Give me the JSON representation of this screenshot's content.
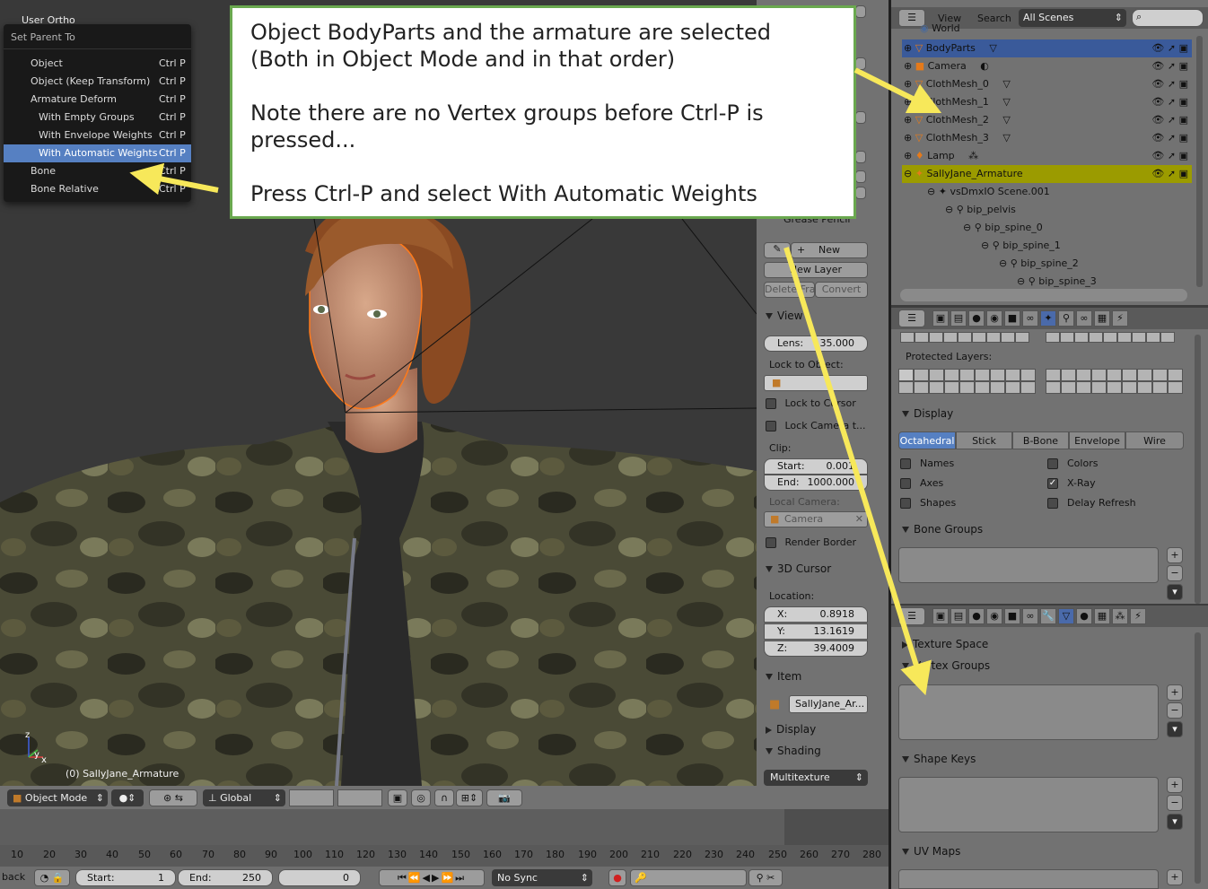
{
  "viewport": {
    "view_name": "User Ortho",
    "object_label": "(0) SallyJane_Armature",
    "axis_x": "x",
    "axis_y": "y",
    "axis_z": "z"
  },
  "parent_menu": {
    "title": "Set Parent To",
    "items": [
      {
        "label": "Object",
        "shortcut": "Ctrl P",
        "indent": false,
        "highlighted": false
      },
      {
        "label": "Object (Keep Transform)",
        "shortcut": "Ctrl P",
        "indent": false,
        "highlighted": false
      },
      {
        "label": "Armature Deform",
        "shortcut": "Ctrl P",
        "indent": false,
        "highlighted": false
      },
      {
        "label": "With Empty Groups",
        "shortcut": "Ctrl P",
        "indent": true,
        "highlighted": false
      },
      {
        "label": "With Envelope Weights",
        "shortcut": "Ctrl P",
        "indent": true,
        "highlighted": false
      },
      {
        "label": "With Automatic Weights",
        "shortcut": "Ctrl P",
        "indent": true,
        "highlighted": true
      },
      {
        "label": "Bone",
        "shortcut": "Ctrl P",
        "indent": false,
        "highlighted": false
      },
      {
        "label": "Bone Relative",
        "shortcut": "Ctrl P",
        "indent": false,
        "highlighted": false
      }
    ]
  },
  "callout": {
    "line1": "Object BodyParts and the armature are selected",
    "line2": "(Both in Object Mode and in that order)",
    "line3": "Note there are no Vertex groups before Ctrl-P is",
    "line4": "pressed...",
    "line5": "Press Ctrl-P and select With Automatic Weights"
  },
  "sidebar": {
    "grease_pencil": "Grease Pencil",
    "new_label": "New",
    "new_layer": "New Layer",
    "delete_label": "Delete Fra",
    "convert_label": "Convert",
    "view_header": "View",
    "lens_label": "Lens:",
    "lens_value": "35.000",
    "lock_to_object": "Lock to Object:",
    "lock_to_cursor": "Lock to Cursor",
    "lock_camera": "Lock Camera t...",
    "clip_label": "Clip:",
    "clip_start_label": "Start:",
    "clip_start_value": "0.001",
    "clip_end_label": "End:",
    "clip_end_value": "1000.000",
    "local_camera": "Local Camera:",
    "camera_field": "Camera",
    "render_border": "Render Border",
    "cursor_header": "3D Cursor",
    "location_label": "Location:",
    "x_label": "X:",
    "x_value": "0.8918",
    "y_label": "Y:",
    "y_value": "13.1619",
    "z_label": "Z:",
    "z_value": "39.4009",
    "item_header": "Item",
    "item_name": "SallyJane_Ar...",
    "display_header": "Display",
    "shading_header": "Shading",
    "shading_mode": "Multitexture"
  },
  "outliner": {
    "view_menu": "View",
    "search_menu": "Search",
    "scene_select": "All Scenes",
    "rows": [
      {
        "label": "World",
        "depth": 1
      },
      {
        "label": "BodyParts",
        "depth": 0
      },
      {
        "label": "Camera",
        "depth": 0
      },
      {
        "label": "ClothMesh_0",
        "depth": 0
      },
      {
        "label": "ClothMesh_1",
        "depth": 0
      },
      {
        "label": "ClothMesh_2",
        "depth": 0
      },
      {
        "label": "ClothMesh_3",
        "depth": 0
      },
      {
        "label": "Lamp",
        "depth": 0
      },
      {
        "label": "SallyJane_Armature",
        "depth": 0
      },
      {
        "label": "vsDmxIO Scene.001",
        "depth": 1
      },
      {
        "label": "bip_pelvis",
        "depth": 2
      },
      {
        "label": "bip_spine_0",
        "depth": 3
      },
      {
        "label": "bip_spine_1",
        "depth": 4
      },
      {
        "label": "bip_spine_2",
        "depth": 5
      },
      {
        "label": "bip_spine_3",
        "depth": 6
      }
    ]
  },
  "armature_props": {
    "protected_layers": "Protected Layers:",
    "display_header": "Display",
    "display_tabs": [
      "Octahedral",
      "Stick",
      "B-Bone",
      "Envelope",
      "Wire"
    ],
    "names": "Names",
    "colors": "Colors",
    "axes": "Axes",
    "xray": "X-Ray",
    "shapes": "Shapes",
    "delay_refresh": "Delay Refresh",
    "bone_groups": "Bone Groups"
  },
  "mesh_props": {
    "texture_space": "Texture Space",
    "vertex_groups": "Vertex Groups",
    "shape_keys": "Shape Keys",
    "uv_maps": "UV Maps"
  },
  "view_header": {
    "mode": "Object Mode",
    "orientation": "Global"
  },
  "timeline": {
    "ticks": [
      "10",
      "20",
      "30",
      "40",
      "50",
      "60",
      "70",
      "80",
      "90",
      "100",
      "110",
      "120",
      "130",
      "140",
      "150",
      "160",
      "170",
      "180",
      "190",
      "200",
      "210",
      "220",
      "230",
      "240",
      "250",
      "260",
      "270",
      "280"
    ],
    "back_label": "back",
    "start_label": "Start:",
    "start_value": "1",
    "end_label": "End:",
    "end_value": "250",
    "current_frame": "0",
    "sync_mode": "No Sync"
  },
  "colors": {
    "accent_selected": "#5680c2",
    "highlight_row": "#9b9b00",
    "callout_border": "#6aa84f",
    "arrow": "#f7e85a"
  }
}
